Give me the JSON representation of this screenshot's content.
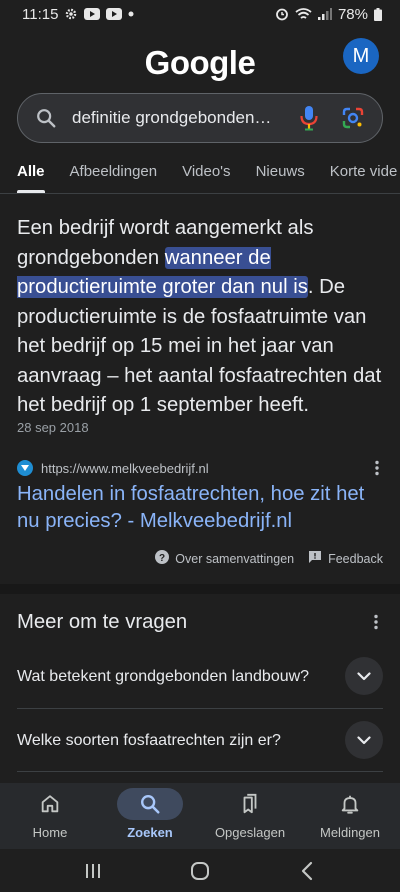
{
  "status_bar": {
    "time": "11:15",
    "battery": "78%"
  },
  "header": {
    "logo_text": "Google",
    "avatar_initial": "M"
  },
  "search": {
    "query": "definitie grondgebonden…"
  },
  "tabs": [
    {
      "label": "Alle",
      "active": true
    },
    {
      "label": "Afbeeldingen"
    },
    {
      "label": "Video's"
    },
    {
      "label": "Nieuws"
    },
    {
      "label": "Korte vide"
    }
  ],
  "snippet": {
    "text_before": "Een bedrijf wordt aangemerkt als grondgebonden ",
    "highlight": "wanneer de productieruimte groter dan nul is",
    "text_after": ". De productieruimte is de fosfaatruimte van het bedrijf op 15 mei in het jaar van aanvraag – het aantal fosfaatrechten dat het bedrijf op 1 september heeft.",
    "date": "28 sep 2018",
    "source_url": "https://www.melkveebedrijf.nl",
    "title": "Handelen in fosfaatrechten, hoe zit het nu precies? - Melkveebedrijf.nl",
    "about_label": "Over samenvattingen",
    "feedback_label": "Feedback"
  },
  "people_also_ask": {
    "title": "Meer om te vragen",
    "questions": [
      "Wat betekent grondgebonden landbouw?",
      "Welke soorten fosfaatrechten zijn er?"
    ]
  },
  "bottom_nav": [
    {
      "label": "Home",
      "icon": "home-icon"
    },
    {
      "label": "Zoeken",
      "icon": "search-icon",
      "active": true
    },
    {
      "label": "Opgeslagen",
      "icon": "bookmarks-icon"
    },
    {
      "label": "Meldingen",
      "icon": "bell-icon"
    }
  ],
  "colors": {
    "background": "#1f1f1f",
    "link": "#8ab4f8",
    "highlight": "#394f93",
    "avatar": "#1a66c2",
    "active_nav": "#a8c7fa"
  }
}
